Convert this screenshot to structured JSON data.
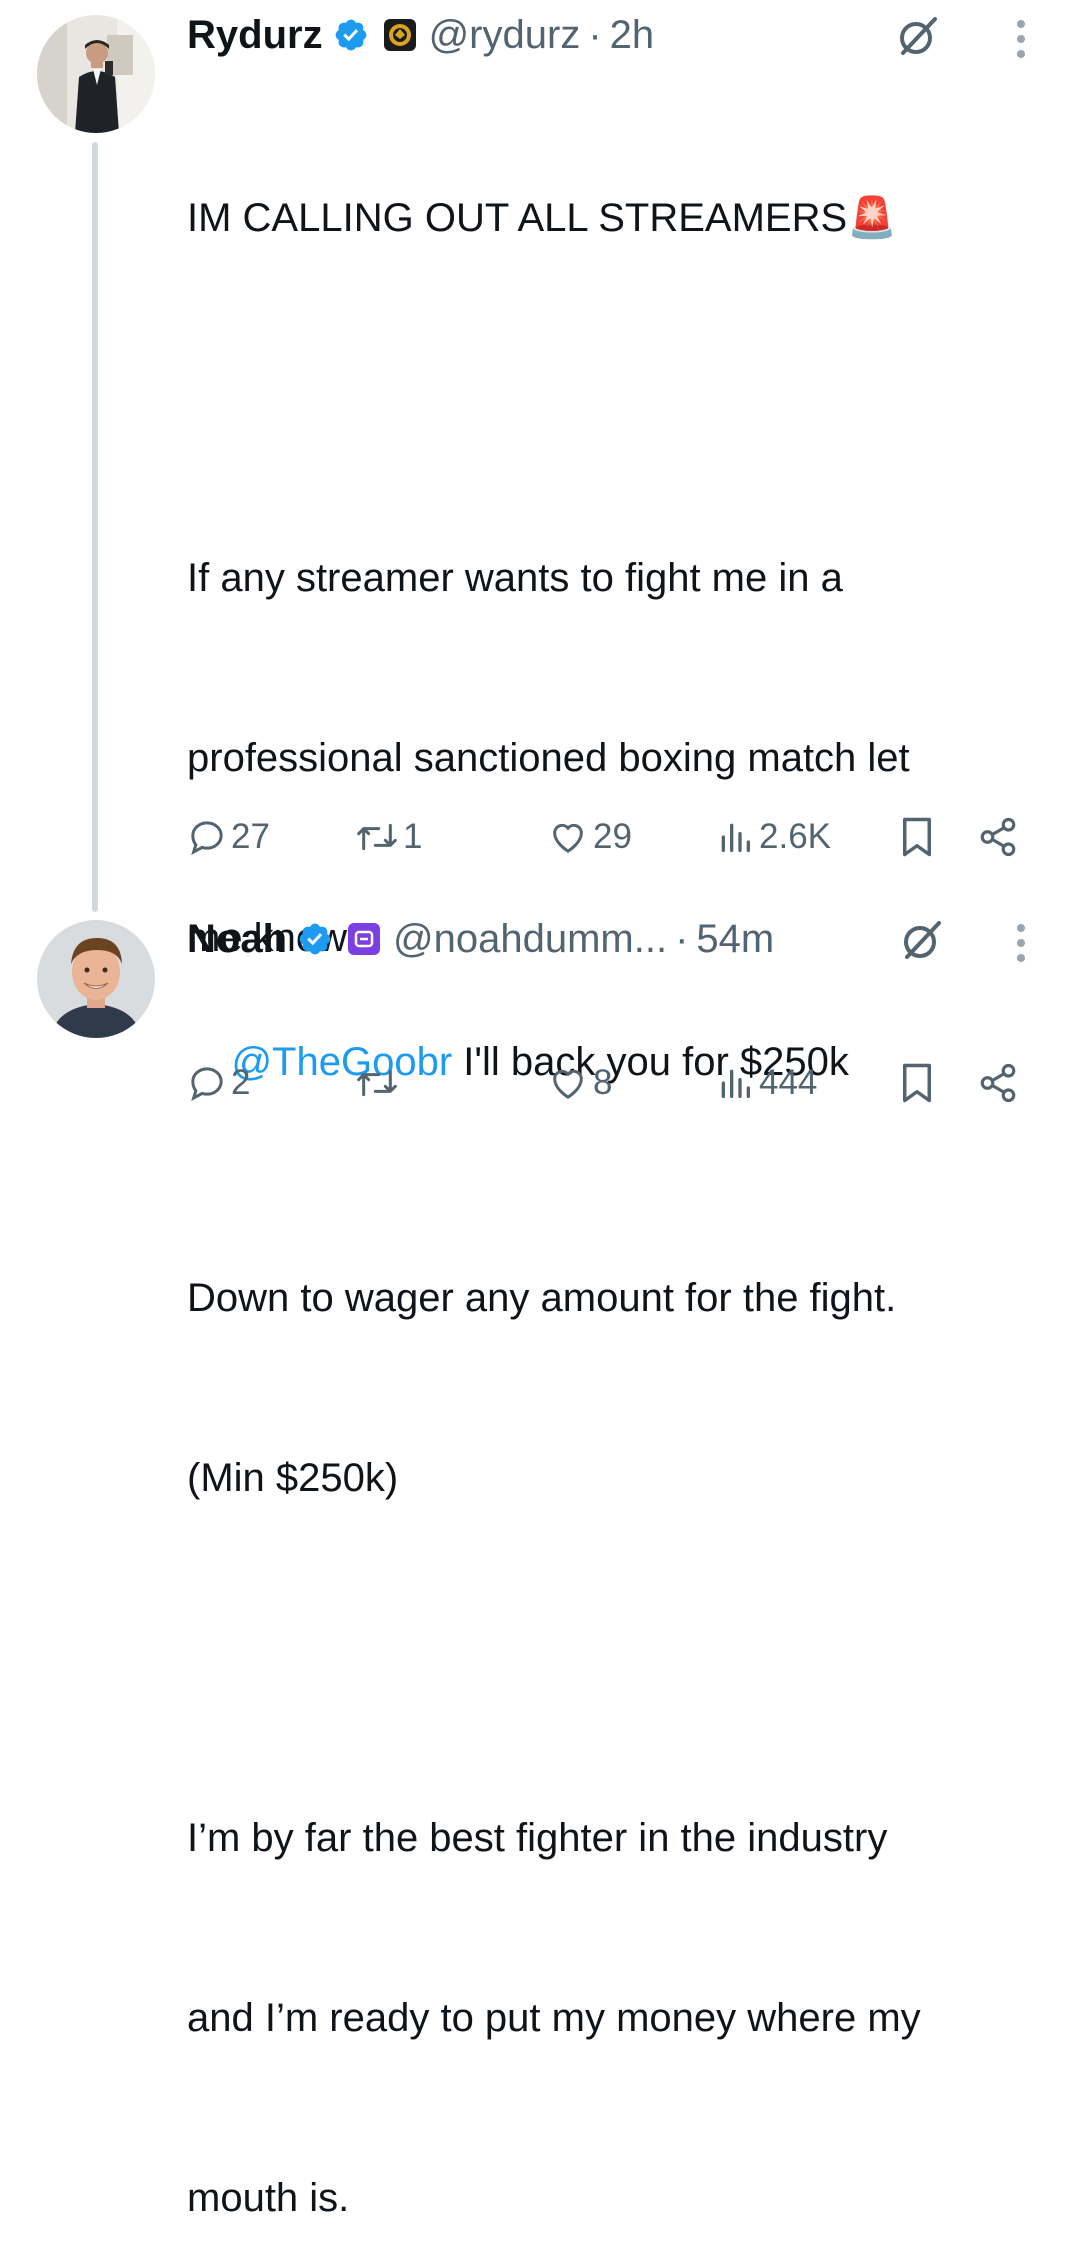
{
  "tweets": [
    {
      "name": "Rydurz",
      "handle": "@rydurz",
      "separator": "·",
      "time": "2h",
      "text_lines": [
        "IM CALLING OUT ALL STREAMERS🚨",
        "",
        "If any streamer wants to fight me in a",
        "professional sanctioned boxing match let",
        "me know.",
        "",
        "Down to wager any amount for the fight.",
        "(Min $250k)",
        "",
        "I’m by far the best fighter in the industry",
        "and I’m ready to put my money where my",
        "mouth is."
      ],
      "stats": {
        "replies": "27",
        "reposts": "1",
        "likes": "29",
        "views": "2.6K"
      }
    },
    {
      "name": "Noah",
      "handle": "@noahdumm...",
      "separator": "·",
      "time": "54m",
      "mention": "@TheGoobr",
      "text": " I'll back you for $250k",
      "stats": {
        "replies": "2",
        "reposts": "",
        "likes": "8",
        "views": "444"
      }
    }
  ],
  "colors": {
    "text": "#0f1419",
    "secondary": "#536471",
    "link": "#1d9bf0",
    "verified": "#1d9bf0",
    "thread_line": "#cfd9de"
  },
  "icons": [
    "verified-badge-icon",
    "affiliate-badge-icon",
    "grok-icon",
    "more-icon",
    "reply-icon",
    "repost-icon",
    "like-icon",
    "views-icon",
    "bookmark-icon",
    "share-icon"
  ]
}
